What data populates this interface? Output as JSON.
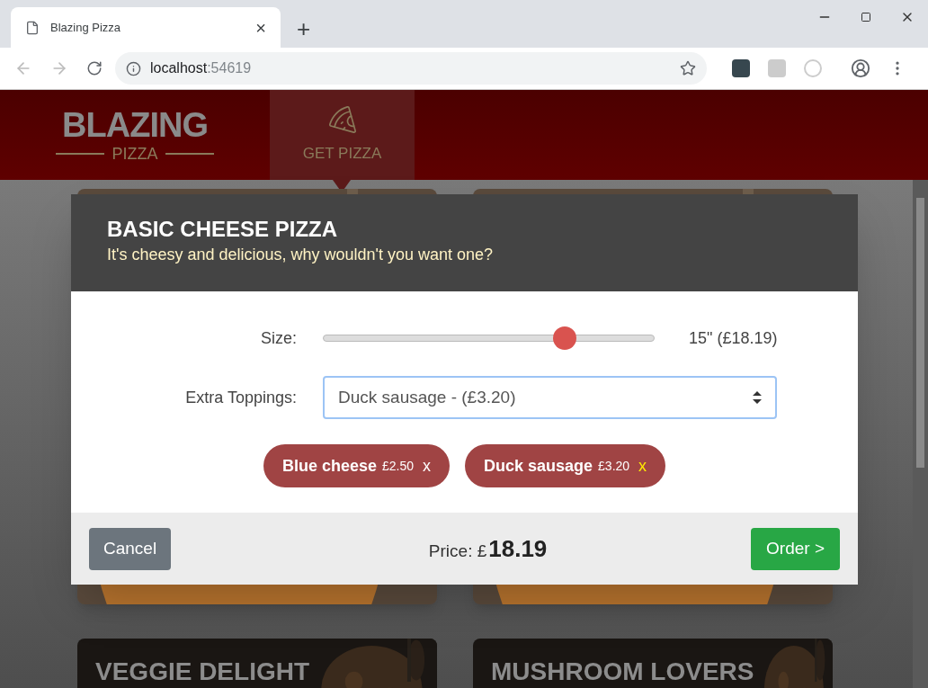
{
  "browser": {
    "tab_title": "Blazing Pizza",
    "tab_close": "×",
    "new_tab": "+",
    "url_host": "localhost",
    "url_port": ":54619"
  },
  "header": {
    "logo_top": "BLAZING",
    "logo_bottom": "PIZZA",
    "nav": [
      {
        "label": "GET PIZZA",
        "selected": true
      }
    ]
  },
  "dialog": {
    "title": "BASIC CHEESE PIZZA",
    "subtitle": "It's cheesy and delicious, why wouldn't you want one?",
    "size_label": "Size:",
    "size_slider": {
      "level": 0.73
    },
    "size_reading": "15\" (£18.19)",
    "toppings_label": "Extra Toppings:",
    "toppings_value": "Duck sausage - (£3.20)",
    "toppings": [
      {
        "name": "Blue cheese",
        "price": "£2.50",
        "remove": "x",
        "hovered": false
      },
      {
        "name": "Duck sausage",
        "price": "£3.20",
        "remove": "x",
        "hovered": true
      }
    ],
    "cancel": "Cancel",
    "price_label": "Price: £",
    "price": "18.19",
    "order": "Order >"
  },
  "cards": [
    {
      "title": "VEGGIE DELIGHT"
    },
    {
      "title": "MUSHROOM LOVERS"
    }
  ]
}
